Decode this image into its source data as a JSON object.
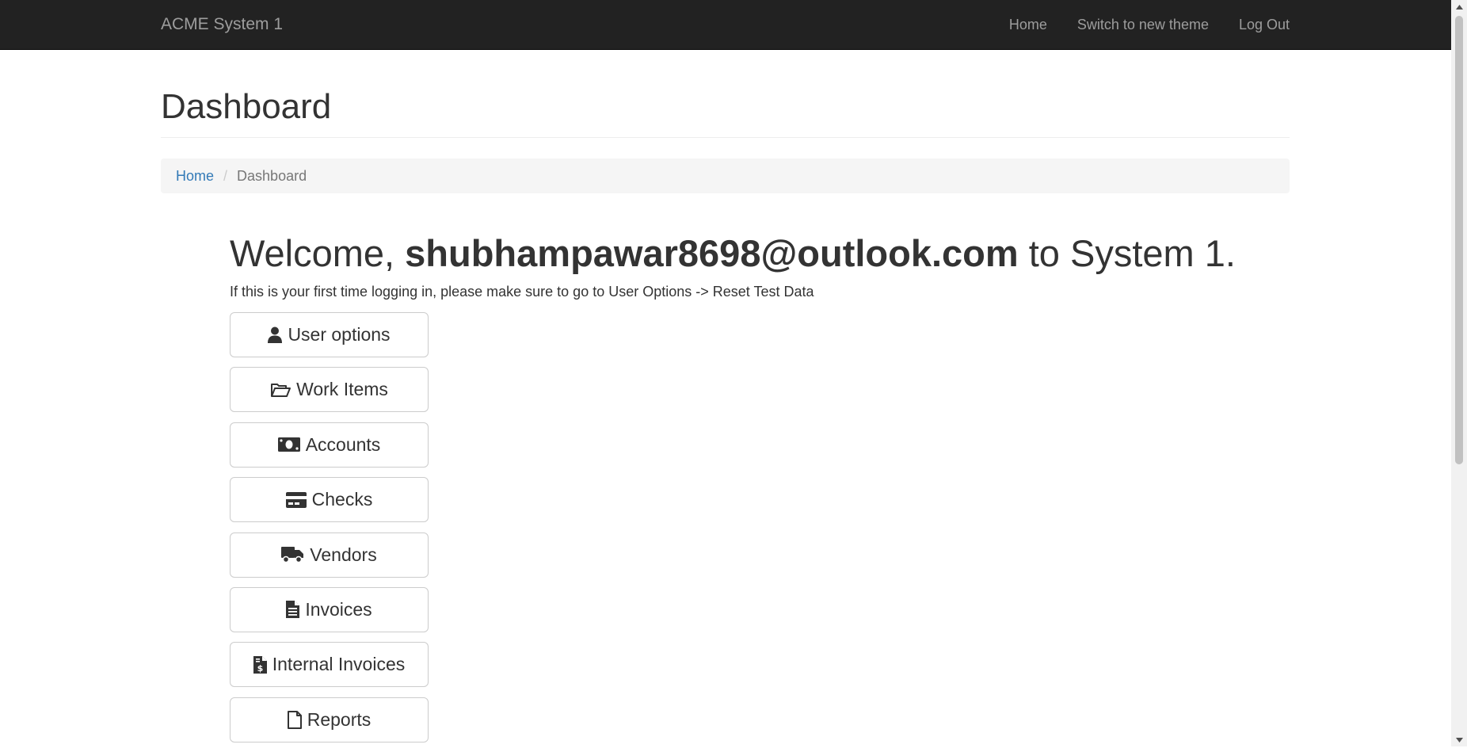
{
  "navbar": {
    "brand": "ACME System 1",
    "links": [
      "Home",
      "Switch to new theme",
      "Log Out"
    ]
  },
  "page": {
    "title": "Dashboard"
  },
  "breadcrumb": {
    "home": "Home",
    "separator": "/",
    "current": "Dashboard"
  },
  "welcome": {
    "prefix": "Welcome,",
    "user": "shubhampawar8698@outlook.com",
    "suffix": "to System 1.",
    "hint": "If this is your first time logging in, please make sure to go to User Options -> Reset Test Data"
  },
  "buttons": [
    {
      "label": "User options",
      "icon": "user-icon"
    },
    {
      "label": "Work Items",
      "icon": "folder-open-icon"
    },
    {
      "label": "Accounts",
      "icon": "money-bill-icon"
    },
    {
      "label": "Checks",
      "icon": "credit-card-icon"
    },
    {
      "label": "Vendors",
      "icon": "truck-icon"
    },
    {
      "label": "Invoices",
      "icon": "file-text-icon"
    },
    {
      "label": "Internal Invoices",
      "icon": "file-invoice-dollar-icon"
    },
    {
      "label": "Reports",
      "icon": "file-icon"
    }
  ],
  "colors": {
    "navbar_bg": "#222222",
    "nav_text": "#9d9d9d",
    "link": "#337ab7",
    "breadcrumb_bg": "#f5f5f5",
    "button_border": "#cccccc"
  }
}
